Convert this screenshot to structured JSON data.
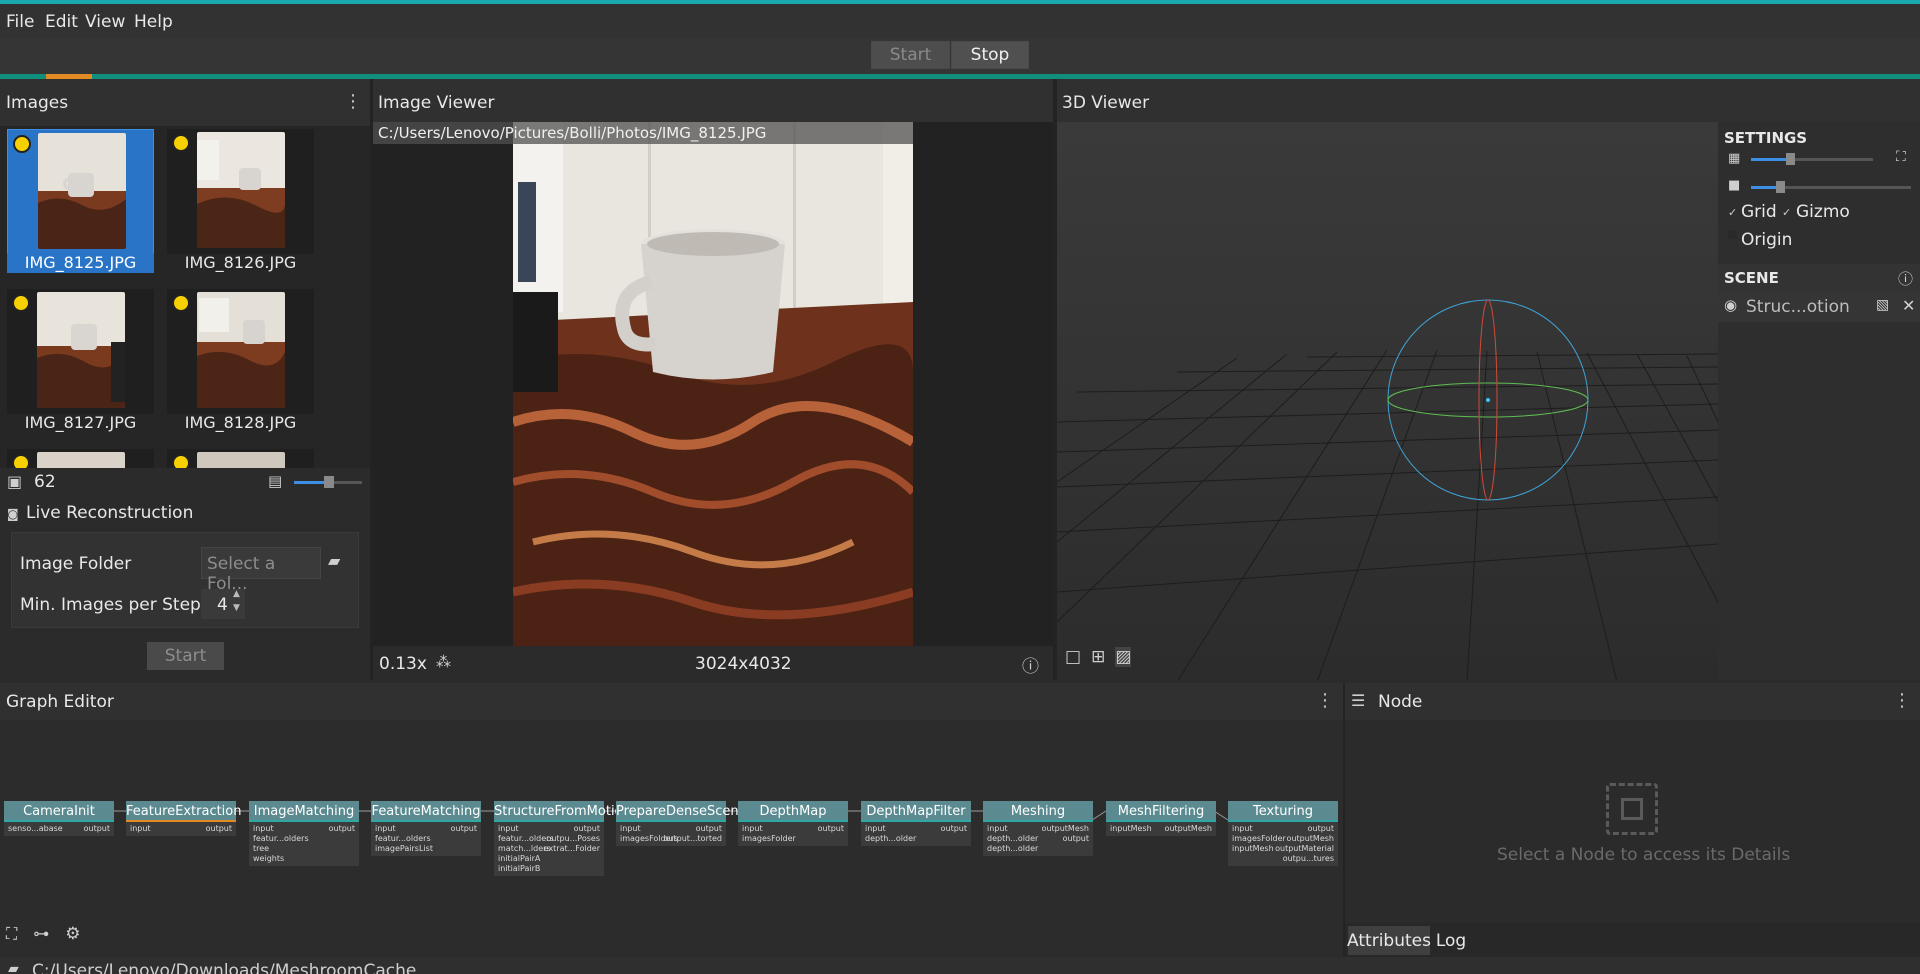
{
  "menu": {
    "items": [
      "File",
      "Edit",
      "View",
      "Help"
    ]
  },
  "toolbar": {
    "start_label": "Start",
    "stop_label": "Stop"
  },
  "images_panel": {
    "title": "Images",
    "thumbnails": [
      {
        "label": "IMG_8125.JPG",
        "selected": true
      },
      {
        "label": "IMG_8126.JPG",
        "selected": false
      },
      {
        "label": "IMG_8127.JPG",
        "selected": false
      },
      {
        "label": "IMG_8128.JPG",
        "selected": false
      }
    ],
    "count": "62",
    "thumb_size_level": 0.5
  },
  "live_reconstruction": {
    "title": "Live Reconstruction",
    "image_folder_label": "Image Folder",
    "image_folder_placeholder": "Select a Fol...",
    "min_images_label": "Min. Images per Step",
    "min_images_value": "4",
    "start_label": "Start"
  },
  "image_viewer": {
    "title": "Image Viewer",
    "path": "C:/Users/Lenovo/Pictures/Bolli/Photos/IMG_8125.JPG",
    "zoom": "0.13x",
    "resolution": "3024x4032"
  },
  "viewer_3d": {
    "title": "3D Viewer",
    "settings_title": "SETTINGS",
    "grid_label": "Grid",
    "gizmo_label": "Gizmo",
    "origin_label": "Origin",
    "scene_title": "SCENE",
    "scene_item": "Struc...otion",
    "point_size_level": 0.32,
    "camera_scale_level": 0.18
  },
  "graph_editor": {
    "title": "Graph Editor",
    "nodes": [
      {
        "name": "CameraInit",
        "inputs": [
          "senso...abase"
        ],
        "outputs": [
          "output"
        ]
      },
      {
        "name": "FeatureExtraction",
        "inputs": [
          "input"
        ],
        "outputs": [
          "output"
        ]
      },
      {
        "name": "ImageMatching",
        "inputs": [
          "input",
          "featur...olders",
          "tree",
          "weights"
        ],
        "outputs": [
          "output"
        ]
      },
      {
        "name": "FeatureMatching",
        "inputs": [
          "input",
          "featur...olders",
          "imagePairsList"
        ],
        "outputs": [
          "output"
        ]
      },
      {
        "name": "StructureFromMotion",
        "inputs": [
          "input",
          "featur...olders",
          "match...lders",
          "initialPairA",
          "initialPairB"
        ],
        "outputs": [
          "output",
          "outpu...Poses",
          "extrat...Folder"
        ]
      },
      {
        "name": "PrepareDenseScene",
        "inputs": [
          "input",
          "imagesFolders"
        ],
        "outputs": [
          "output",
          "output...torted"
        ]
      },
      {
        "name": "DepthMap",
        "inputs": [
          "input",
          "imagesFolder"
        ],
        "outputs": [
          "output"
        ]
      },
      {
        "name": "DepthMapFilter",
        "inputs": [
          "input",
          "depth...older"
        ],
        "outputs": [
          "output"
        ]
      },
      {
        "name": "Meshing",
        "inputs": [
          "input",
          "depth...older",
          "depth...older"
        ],
        "outputs": [
          "outputMesh",
          "output"
        ]
      },
      {
        "name": "MeshFiltering",
        "inputs": [
          "inputMesh"
        ],
        "outputs": [
          "outputMesh"
        ]
      },
      {
        "name": "Texturing",
        "inputs": [
          "input",
          "imagesFolder",
          "inputMesh"
        ],
        "outputs": [
          "output",
          "outputMesh",
          "outputMaterial",
          "outpu...tures"
        ]
      }
    ]
  },
  "node_panel": {
    "title": "Node",
    "empty_message": "Select a Node to access its Details",
    "tabs": [
      "Attributes",
      "Log"
    ]
  },
  "status_bar": {
    "cache_path": "C:/Users/Lenovo/Downloads/MeshroomCache"
  },
  "colors": {
    "accent": "#19a8b0",
    "selection": "#2a74c7",
    "node_header": "#5b8a91",
    "progress": "#0f8f7c",
    "progress_active": "#e28a23"
  }
}
